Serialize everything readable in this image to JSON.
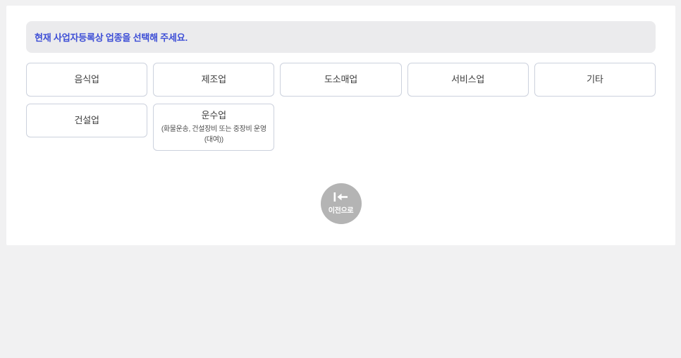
{
  "notice": {
    "text": "현재 사업자등록상 업종을 선택해 주세요.",
    "text_color": "#3d4ed6",
    "background_color": "#ebebed"
  },
  "business_type_options": [
    {
      "label": "음식업"
    },
    {
      "label": "제조업"
    },
    {
      "label": "도소매업"
    },
    {
      "label": "서비스업"
    },
    {
      "label": "기타"
    },
    {
      "label": "건설업"
    },
    {
      "label": "운수업",
      "sublabel": "(화물운송, 건설장비 또는 중장비 운영\n(대여))"
    }
  ],
  "back_button": {
    "label": "이전으로",
    "icon": "arrow-left-to-bar-icon",
    "background_color": "#b4b4b4"
  },
  "colors": {
    "page_background": "#f1f1f2",
    "panel_background": "#ffffff",
    "button_border": "#ccd1dd",
    "button_text": "#3d3d3d"
  }
}
